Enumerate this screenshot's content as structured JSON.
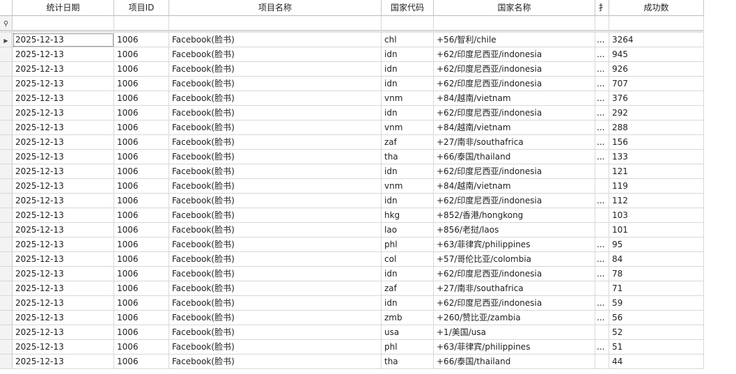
{
  "headers": [
    "统计日期",
    "项目ID",
    "项目名称",
    "国家代码",
    "国家名称",
    "扌",
    "成功数"
  ],
  "filter_icon": "pin-icon",
  "current_row_icon": "current-row-arrow-icon",
  "rows": [
    {
      "date": "2025-12-13",
      "pid": "1006",
      "pname": "Facebook(脸书)",
      "code": "chl",
      "country": "+56/智利/chile",
      "trunc": "...",
      "count": "3264"
    },
    {
      "date": "2025-12-13",
      "pid": "1006",
      "pname": "Facebook(脸书)",
      "code": "idn",
      "country": "+62/印度尼西亚/indonesia",
      "trunc": "...",
      "count": "945"
    },
    {
      "date": "2025-12-13",
      "pid": "1006",
      "pname": "Facebook(脸书)",
      "code": "idn",
      "country": "+62/印度尼西亚/indonesia",
      "trunc": "...",
      "count": "926"
    },
    {
      "date": "2025-12-13",
      "pid": "1006",
      "pname": "Facebook(脸书)",
      "code": "idn",
      "country": "+62/印度尼西亚/indonesia",
      "trunc": "...",
      "count": "707"
    },
    {
      "date": "2025-12-13",
      "pid": "1006",
      "pname": "Facebook(脸书)",
      "code": "vnm",
      "country": "+84/越南/vietnam",
      "trunc": "...",
      "count": "376"
    },
    {
      "date": "2025-12-13",
      "pid": "1006",
      "pname": "Facebook(脸书)",
      "code": "idn",
      "country": "+62/印度尼西亚/indonesia",
      "trunc": "...",
      "count": "292"
    },
    {
      "date": "2025-12-13",
      "pid": "1006",
      "pname": "Facebook(脸书)",
      "code": "vnm",
      "country": "+84/越南/vietnam",
      "trunc": "...",
      "count": "288"
    },
    {
      "date": "2025-12-13",
      "pid": "1006",
      "pname": "Facebook(脸书)",
      "code": "zaf",
      "country": "+27/南非/southafrica",
      "trunc": "...",
      "count": "156"
    },
    {
      "date": "2025-12-13",
      "pid": "1006",
      "pname": "Facebook(脸书)",
      "code": "tha",
      "country": "+66/泰国/thailand",
      "trunc": "...",
      "count": "133"
    },
    {
      "date": "2025-12-13",
      "pid": "1006",
      "pname": "Facebook(脸书)",
      "code": "idn",
      "country": "+62/印度尼西亚/indonesia",
      "trunc": "",
      "count": "121"
    },
    {
      "date": "2025-12-13",
      "pid": "1006",
      "pname": "Facebook(脸书)",
      "code": "vnm",
      "country": "+84/越南/vietnam",
      "trunc": "",
      "count": "119"
    },
    {
      "date": "2025-12-13",
      "pid": "1006",
      "pname": "Facebook(脸书)",
      "code": "idn",
      "country": "+62/印度尼西亚/indonesia",
      "trunc": "...",
      "count": "112"
    },
    {
      "date": "2025-12-13",
      "pid": "1006",
      "pname": "Facebook(脸书)",
      "code": "hkg",
      "country": "+852/香港/hongkong",
      "trunc": "",
      "count": "103"
    },
    {
      "date": "2025-12-13",
      "pid": "1006",
      "pname": "Facebook(脸书)",
      "code": "lao",
      "country": "+856/老挝/laos",
      "trunc": "",
      "count": "101"
    },
    {
      "date": "2025-12-13",
      "pid": "1006",
      "pname": "Facebook(脸书)",
      "code": "phl",
      "country": "+63/菲律宾/philippines",
      "trunc": "...",
      "count": "95"
    },
    {
      "date": "2025-12-13",
      "pid": "1006",
      "pname": "Facebook(脸书)",
      "code": "col",
      "country": "+57/哥伦比亚/colombia",
      "trunc": "...",
      "count": "84"
    },
    {
      "date": "2025-12-13",
      "pid": "1006",
      "pname": "Facebook(脸书)",
      "code": "idn",
      "country": "+62/印度尼西亚/indonesia",
      "trunc": "...",
      "count": "78"
    },
    {
      "date": "2025-12-13",
      "pid": "1006",
      "pname": "Facebook(脸书)",
      "code": "zaf",
      "country": "+27/南非/southafrica",
      "trunc": "",
      "count": "71"
    },
    {
      "date": "2025-12-13",
      "pid": "1006",
      "pname": "Facebook(脸书)",
      "code": "idn",
      "country": "+62/印度尼西亚/indonesia",
      "trunc": "...",
      "count": "59"
    },
    {
      "date": "2025-12-13",
      "pid": "1006",
      "pname": "Facebook(脸书)",
      "code": "zmb",
      "country": "+260/赞比亚/zambia",
      "trunc": "...",
      "count": "56"
    },
    {
      "date": "2025-12-13",
      "pid": "1006",
      "pname": "Facebook(脸书)",
      "code": "usa",
      "country": "+1/美国/usa",
      "trunc": "",
      "count": "52"
    },
    {
      "date": "2025-12-13",
      "pid": "1006",
      "pname": "Facebook(脸书)",
      "code": "phl",
      "country": "+63/菲律宾/philippines",
      "trunc": "...",
      "count": "51"
    },
    {
      "date": "2025-12-13",
      "pid": "1006",
      "pname": "Facebook(脸书)",
      "code": "tha",
      "country": "+66/泰国/thailand",
      "trunc": "",
      "count": "44"
    }
  ]
}
